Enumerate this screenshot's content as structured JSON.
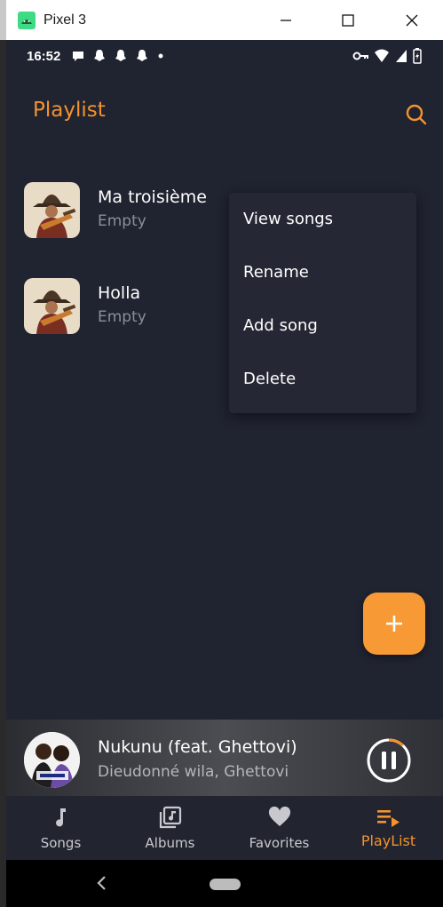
{
  "window": {
    "title": "Pixel 3"
  },
  "status_bar": {
    "time": "16:52"
  },
  "appbar": {
    "title": "Playlist"
  },
  "playlists": [
    {
      "name": "Ma troisième",
      "subtitle": "Empty"
    },
    {
      "name": "Holla",
      "subtitle": "Empty"
    }
  ],
  "context_menu": {
    "items": [
      "View songs",
      "Rename",
      "Add song",
      "Delete"
    ]
  },
  "fab": {
    "label": "+"
  },
  "now_playing": {
    "title": "Nukunu (feat. Ghettovi)",
    "artist": "Dieudonné wila, Ghettovi",
    "progress": 0.12
  },
  "bottom_nav": {
    "items": [
      {
        "label": "Songs",
        "icon": "music-note-icon",
        "active": false
      },
      {
        "label": "Albums",
        "icon": "album-icon",
        "active": false
      },
      {
        "label": "Favorites",
        "icon": "heart-icon",
        "active": false
      },
      {
        "label": "PlayList",
        "icon": "playlist-icon",
        "active": true
      }
    ]
  },
  "colors": {
    "accent": "#f5922d",
    "background": "#202330",
    "menu": "#252834"
  }
}
